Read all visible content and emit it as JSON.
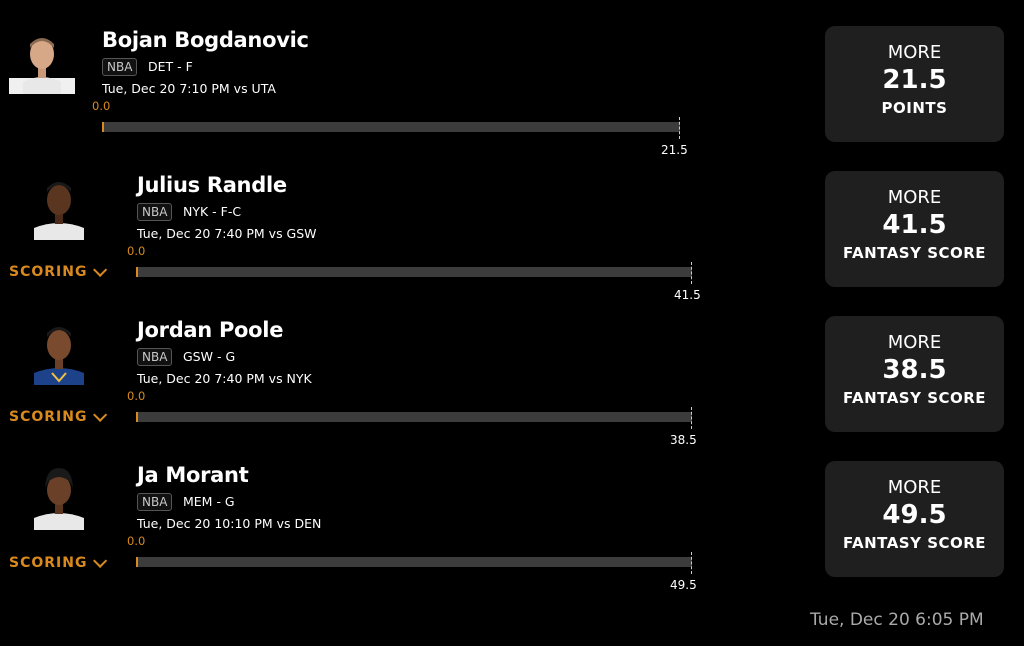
{
  "picks": [
    {
      "name": "Bojan Bogdanovic",
      "league": "NBA",
      "team_pos": "DET - F",
      "game": "Tue, Dec 20 7:10 PM  vs UTA",
      "bar_start": "0.0",
      "bar_end": "21.5",
      "scoring": null,
      "card": {
        "direction": "MORE",
        "line": "21.5",
        "stat": "POINTS"
      },
      "jersey_color": "#e8e8e8"
    },
    {
      "name": "Julius Randle",
      "league": "NBA",
      "team_pos": "NYK - F-C",
      "game": "Tue, Dec 20 7:40 PM  vs GSW",
      "bar_start": "0.0",
      "bar_end": "41.5",
      "scoring": "SCORING",
      "card": {
        "direction": "MORE",
        "line": "41.5",
        "stat": "FANTASY SCORE"
      },
      "jersey_color": "#e8e8e8"
    },
    {
      "name": "Jordan Poole",
      "league": "NBA",
      "team_pos": "GSW - G",
      "game": "Tue, Dec 20 7:40 PM  vs NYK",
      "bar_start": "0.0",
      "bar_end": "38.5",
      "scoring": "SCORING",
      "card": {
        "direction": "MORE",
        "line": "38.5",
        "stat": "FANTASY SCORE"
      },
      "jersey_color": "#1d428a"
    },
    {
      "name": "Ja Morant",
      "league": "NBA",
      "team_pos": "MEM - G",
      "game": "Tue, Dec 20 10:10 PM  vs DEN",
      "bar_start": "0.0",
      "bar_end": "49.5",
      "scoring": "SCORING",
      "card": {
        "direction": "MORE",
        "line": "49.5",
        "stat": "FANTASY SCORE"
      },
      "jersey_color": "#e8e8e8"
    }
  ],
  "footer": {
    "timestamp": "Tue, Dec 20 6:05 PM"
  },
  "colors": {
    "accent": "#d98a1e",
    "card_bg": "#1f1f1f",
    "bar_track": "#3c3c3c"
  }
}
